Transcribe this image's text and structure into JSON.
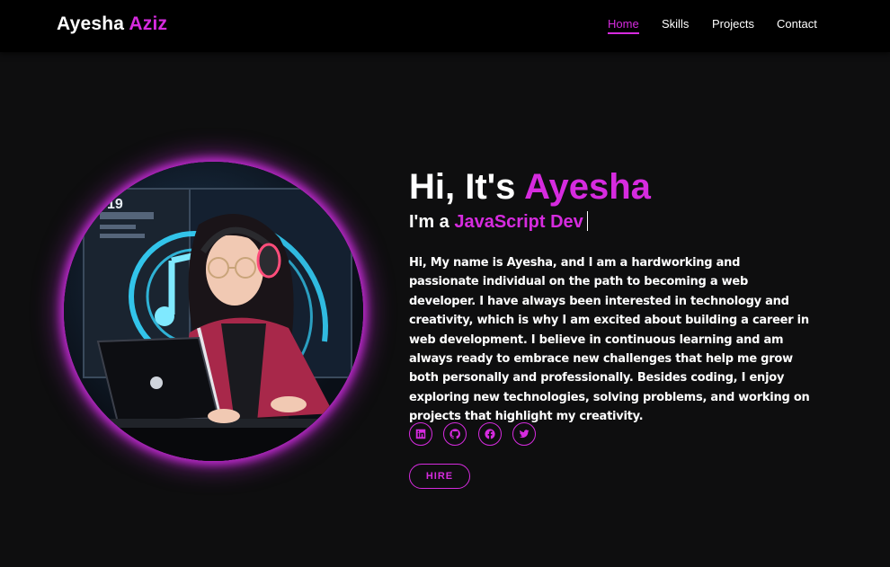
{
  "header": {
    "logo_first": "Ayesha",
    "logo_second": "Aziz",
    "nav": [
      {
        "label": "Home",
        "active": true
      },
      {
        "label": "Skills",
        "active": false
      },
      {
        "label": "Projects",
        "active": false
      },
      {
        "label": "Contact",
        "active": false
      }
    ]
  },
  "hero": {
    "greeting_prefix": "Hi, It's",
    "greeting_name": "Ayesha",
    "role_prefix": "I'm a",
    "role_typed": "JavaScript Dev",
    "bio": "Hi, My name is Ayesha, and I am a hardworking and passionate individual on the path to becoming a web developer. I have always been interested in technology and creativity, which is why I am excited about building a career in web development. I believe in continuous learning and am always ready to embrace new challenges that help me grow both personally and professionally. Besides coding, I enjoy exploring new technologies, solving problems, and working on projects that highlight my creativity.",
    "socials": [
      {
        "icon": "linkedin-icon"
      },
      {
        "icon": "github-icon"
      },
      {
        "icon": "facebook-icon"
      },
      {
        "icon": "twitter-icon"
      }
    ],
    "hire_label": "HIRE",
    "portrait_screen_number": "19"
  },
  "colors": {
    "accent": "#d62bdf",
    "background": "#0e0e0f",
    "navbar": "#000000",
    "neon": "#35d6ff"
  }
}
